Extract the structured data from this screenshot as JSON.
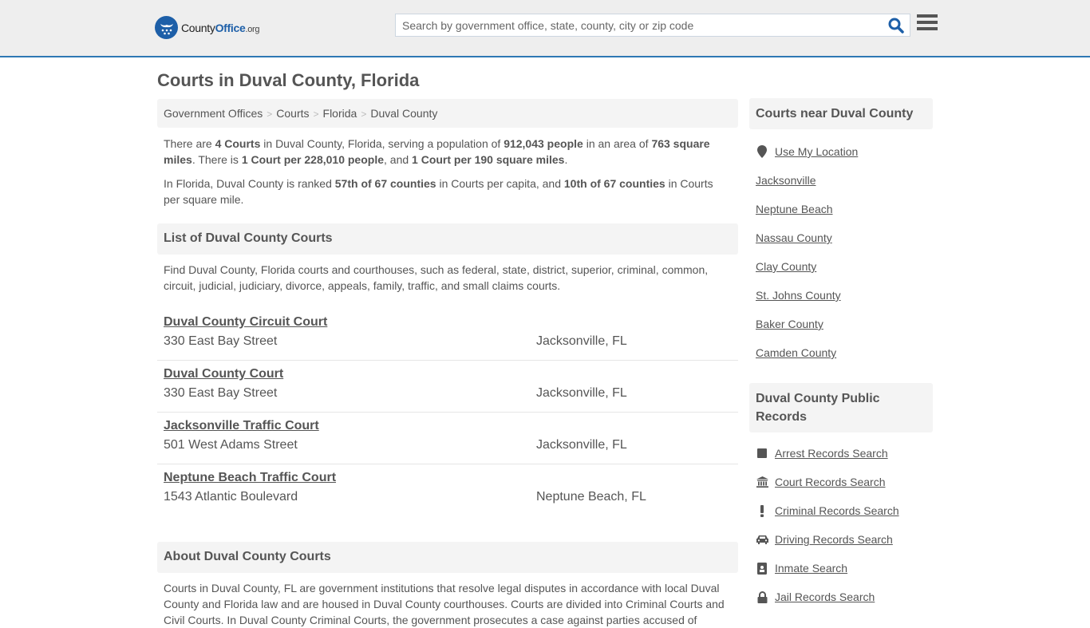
{
  "header": {
    "logo": {
      "county": "County",
      "office": "Office",
      "org": ".org"
    },
    "search": {
      "placeholder": "Search by government office, state, county, city or zip code",
      "value": ""
    },
    "colors": {
      "brand": "#1d5fa8",
      "header_border": "#2e78b4",
      "header_bg": "#eeeeee"
    }
  },
  "page": {
    "title": "Courts in Duval County, Florida"
  },
  "breadcrumb": [
    {
      "label": "Government Offices"
    },
    {
      "label": "Courts"
    },
    {
      "label": "Florida"
    },
    {
      "label": "Duval County"
    }
  ],
  "summary": {
    "p1": {
      "t1": "There are ",
      "b1": "4 Courts",
      "t2": " in Duval County, Florida, serving a population of ",
      "b2": "912,043 people",
      "t3": " in an area of ",
      "b3": "763 square miles",
      "t4": ". There is ",
      "b4": "1 Court per 228,010 people",
      "t5": ", and ",
      "b5": "1 Court per 190 square miles",
      "t6": "."
    },
    "p2": {
      "t1": "In Florida, Duval County is ranked ",
      "b1": "57th of 67 counties",
      "t2": " in Courts per capita, and ",
      "b2": "10th of 67 counties",
      "t3": " in Courts per square mile."
    }
  },
  "list_section": {
    "heading": "List of Duval County Courts",
    "intro": "Find Duval County, Florida courts and courthouses, such as federal, state, district, superior, criminal, common, circuit, judicial, judiciary, divorce, appeals, family, traffic, and small claims courts.",
    "courts": [
      {
        "name": "Duval County Circuit Court",
        "address": "330 East Bay Street",
        "city": "Jacksonville, FL"
      },
      {
        "name": "Duval County Court",
        "address": "330 East Bay Street",
        "city": "Jacksonville, FL"
      },
      {
        "name": "Jacksonville Traffic Court",
        "address": "501 West Adams Street",
        "city": "Jacksonville, FL"
      },
      {
        "name": "Neptune Beach Traffic Court",
        "address": "1543 Atlantic Boulevard",
        "city": "Neptune Beach, FL"
      }
    ]
  },
  "about_section": {
    "heading": "About Duval County Courts",
    "text": "Courts in Duval County, FL are government institutions that resolve legal disputes in accordance with local Duval County and Florida law and are housed in Duval County courthouses. Courts are divided into Criminal Courts and Civil Courts. In Duval County Criminal Courts, the government prosecutes a case against parties accused of"
  },
  "sidebar": {
    "near": {
      "heading": "Courts near Duval County",
      "use_location": {
        "label": "Use My Location",
        "icon": "map-marker-icon"
      },
      "links": [
        "Jacksonville",
        "Neptune Beach",
        "Nassau County",
        "Clay County",
        "St. Johns County",
        "Baker County",
        "Camden County"
      ]
    },
    "records": {
      "heading": "Duval County Public Records",
      "links": [
        {
          "label": "Arrest Records Search",
          "icon": "square-icon"
        },
        {
          "label": "Court Records Search",
          "icon": "courthouse-icon"
        },
        {
          "label": "Criminal Records Search",
          "icon": "exclamation-icon"
        },
        {
          "label": "Driving Records Search",
          "icon": "car-icon"
        },
        {
          "label": "Inmate Search",
          "icon": "id-badge-icon"
        },
        {
          "label": "Jail Records Search",
          "icon": "lock-icon"
        }
      ]
    }
  }
}
